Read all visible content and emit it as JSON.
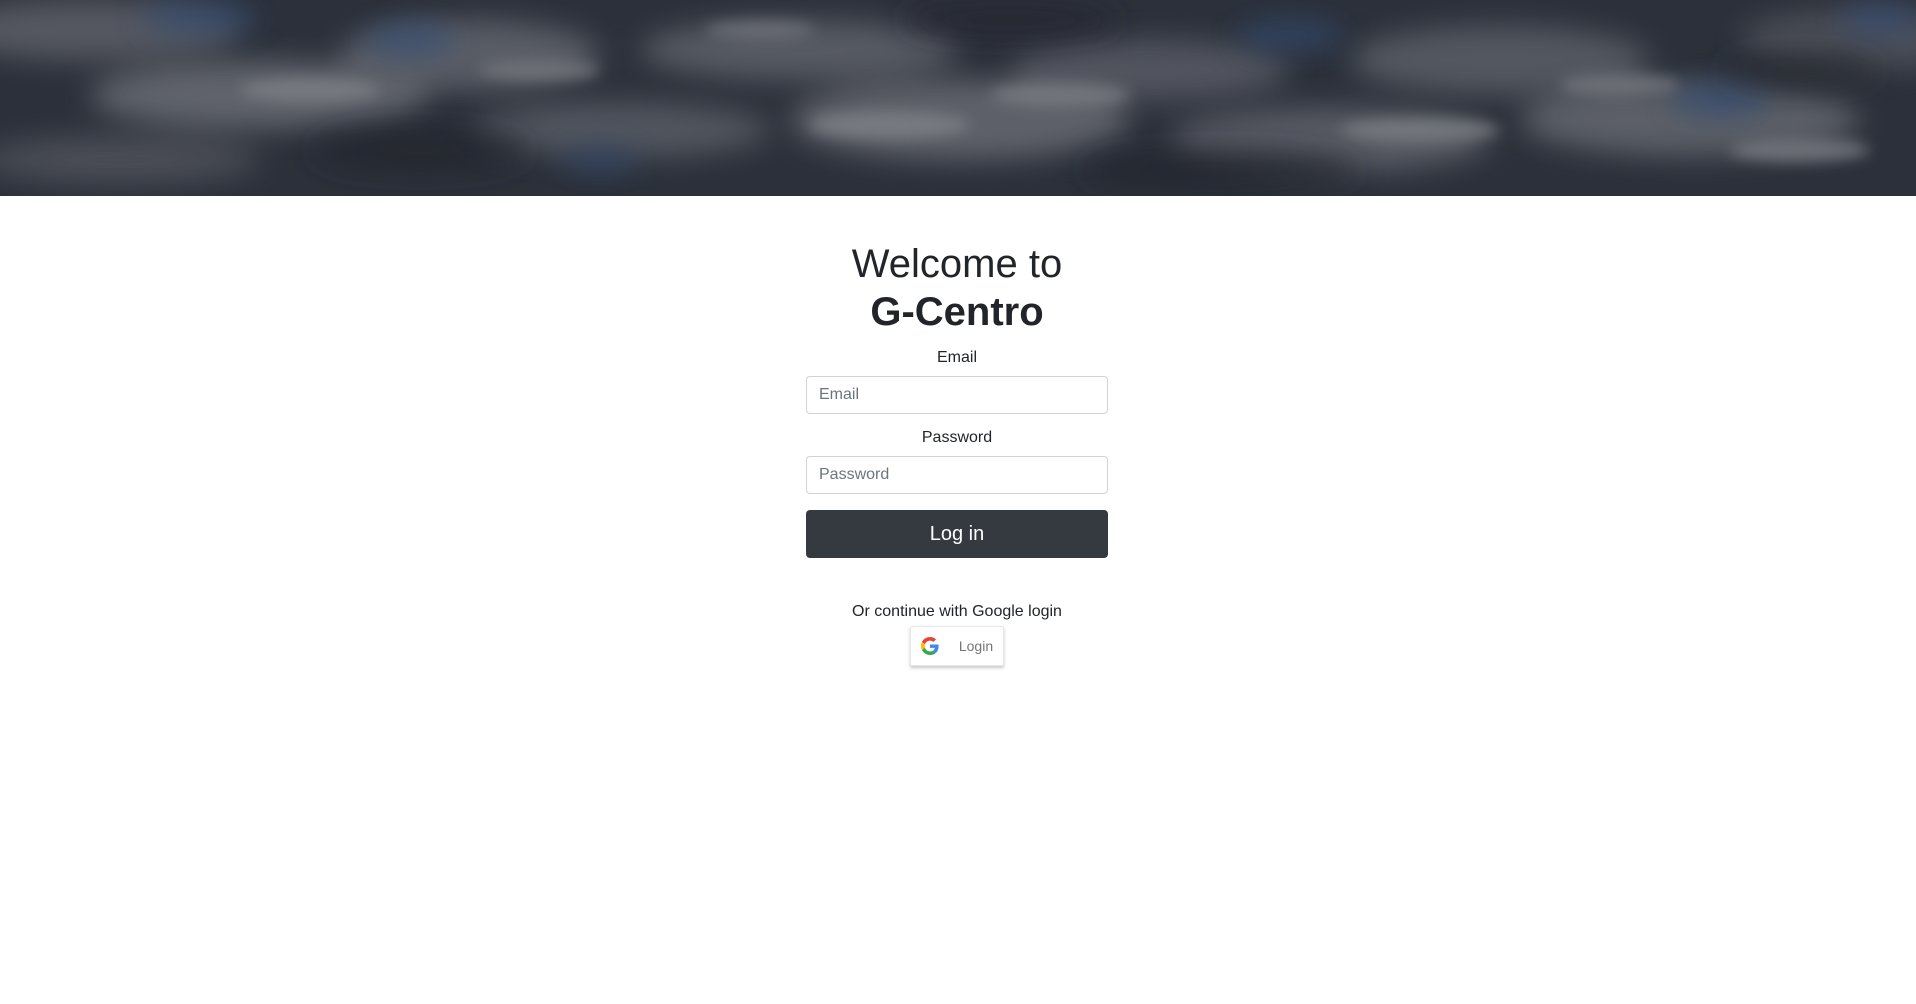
{
  "hero": {
    "image": "cloudy-sky-banner"
  },
  "heading": {
    "welcome": "Welcome to",
    "brand": "G-Centro"
  },
  "form": {
    "email_label": "Email",
    "email_placeholder": "Email",
    "email_value": "",
    "password_label": "Password",
    "password_placeholder": "Password",
    "password_value": "",
    "submit_label": "Log in"
  },
  "alt_login": {
    "text": "Or continue with Google login",
    "button_label": "Login",
    "icon": "google-icon"
  },
  "colors": {
    "primary_button": "#343a40",
    "text": "#212529",
    "hero_overlay": "#2f3440"
  }
}
